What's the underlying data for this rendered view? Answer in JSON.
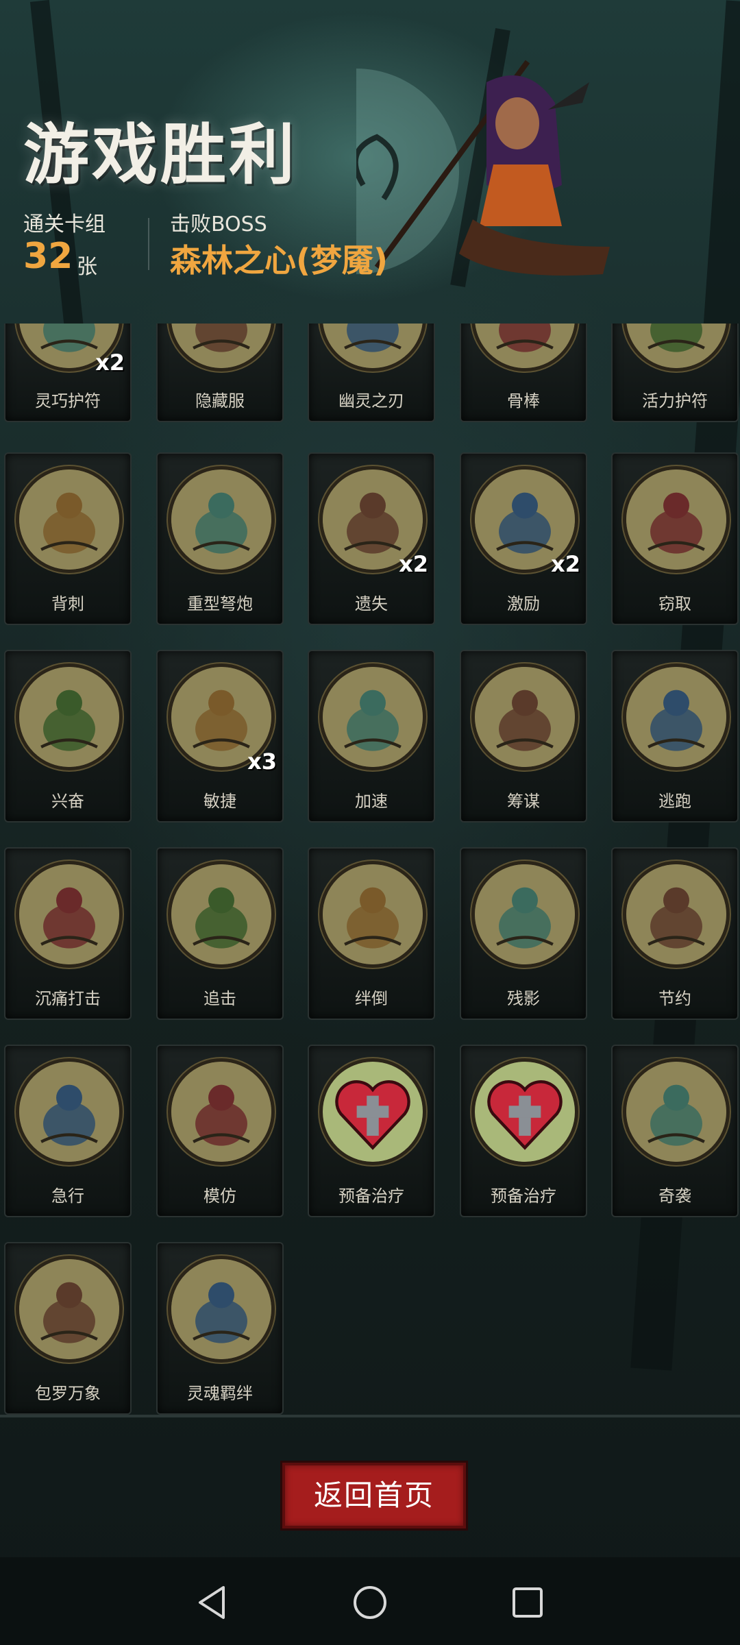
{
  "header": {
    "title": "游戏胜利",
    "deck_label": "通关卡组",
    "deck_count": "32",
    "deck_unit": "张",
    "boss_label": "击败BOSS",
    "boss_name": "森林之心(梦魇)"
  },
  "cards": [
    {
      "name": "灵巧护符",
      "mult": "x2",
      "icon": "amulet-icon"
    },
    {
      "name": "隐藏服",
      "mult": "",
      "icon": "cloak-icon"
    },
    {
      "name": "幽灵之刃",
      "mult": "",
      "icon": "ghost-blade-icon"
    },
    {
      "name": "骨棒",
      "mult": "",
      "icon": "bone-club-icon"
    },
    {
      "name": "活力护符",
      "mult": "",
      "icon": "vitality-amulet-icon"
    },
    {
      "name": "背刺",
      "mult": "",
      "icon": "backstab-icon"
    },
    {
      "name": "重型弩炮",
      "mult": "",
      "icon": "ballista-icon"
    },
    {
      "name": "遗失",
      "mult": "x2",
      "icon": "lost-icon"
    },
    {
      "name": "激励",
      "mult": "x2",
      "icon": "inspire-icon"
    },
    {
      "name": "窃取",
      "mult": "",
      "icon": "steal-icon"
    },
    {
      "name": "兴奋",
      "mult": "",
      "icon": "excite-icon"
    },
    {
      "name": "敏捷",
      "mult": "x3",
      "icon": "agility-icon"
    },
    {
      "name": "加速",
      "mult": "",
      "icon": "haste-icon"
    },
    {
      "name": "筹谋",
      "mult": "",
      "icon": "scheme-icon"
    },
    {
      "name": "逃跑",
      "mult": "",
      "icon": "flee-icon"
    },
    {
      "name": "沉痛打击",
      "mult": "",
      "icon": "heavy-strike-icon"
    },
    {
      "name": "追击",
      "mult": "",
      "icon": "pursuit-icon"
    },
    {
      "name": "绊倒",
      "mult": "",
      "icon": "trip-icon"
    },
    {
      "name": "残影",
      "mult": "",
      "icon": "afterimage-icon"
    },
    {
      "name": "节约",
      "mult": "",
      "icon": "thrift-icon"
    },
    {
      "name": "急行",
      "mult": "",
      "icon": "dash-icon"
    },
    {
      "name": "模仿",
      "mult": "",
      "icon": "mimic-icon"
    },
    {
      "name": "预备治疗",
      "mult": "",
      "icon": "heart-cross-icon"
    },
    {
      "name": "预备治疗",
      "mult": "",
      "icon": "heart-cross-icon"
    },
    {
      "name": "奇袭",
      "mult": "",
      "icon": "ambush-icon"
    },
    {
      "name": "包罗万象",
      "mult": "",
      "icon": "all-encompassing-icon"
    },
    {
      "name": "灵魂羁绊",
      "mult": "",
      "icon": "soul-bond-icon"
    }
  ],
  "back_button_label": "返回首页",
  "colors": {
    "accent_orange": "#f0a640",
    "button_red": "#a51d1d",
    "card_art_bg": "#8e8558"
  }
}
